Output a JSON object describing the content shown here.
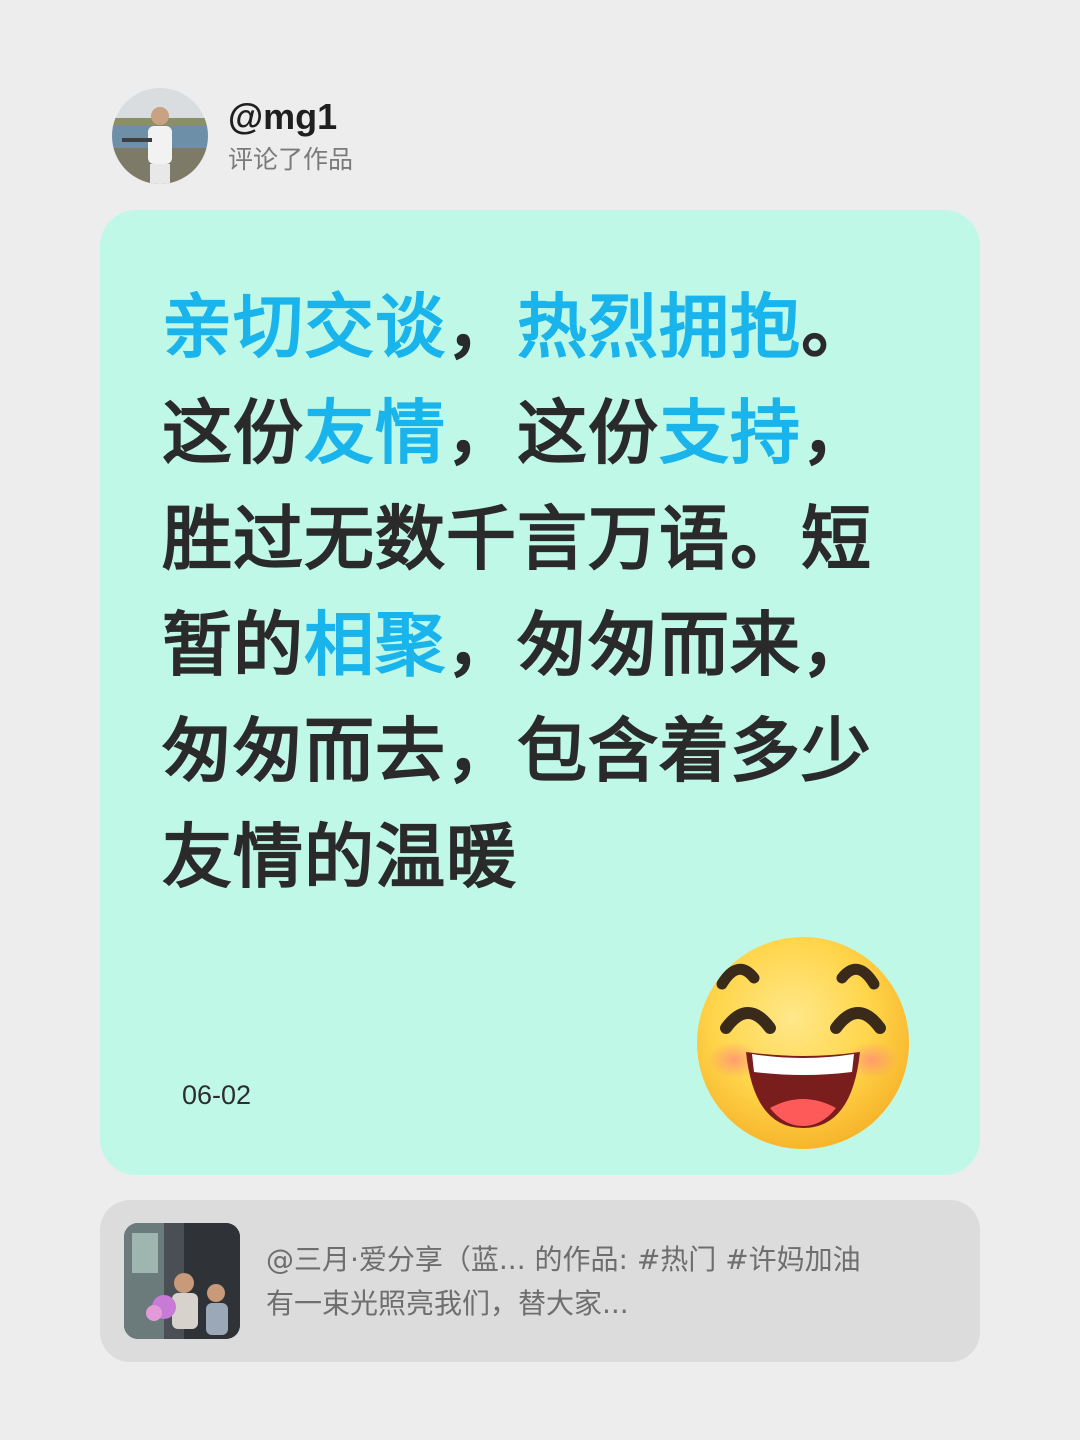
{
  "header": {
    "username": "@mg1",
    "action": "评论了作品"
  },
  "comment": {
    "lines": [
      [
        {
          "text": "亲切交谈",
          "hl": true
        },
        {
          "text": "，",
          "hl": false
        },
        {
          "text": "热烈拥抱",
          "hl": true
        },
        {
          "text": "。",
          "hl": false
        }
      ],
      [
        {
          "text": "这份",
          "hl": false
        },
        {
          "text": "友情",
          "hl": true
        },
        {
          "text": "，这份",
          "hl": false
        },
        {
          "text": "支持",
          "hl": true
        },
        {
          "text": "，",
          "hl": false
        }
      ],
      [
        {
          "text": "胜过无数千言万语。短",
          "hl": false
        }
      ],
      [
        {
          "text": "暂的",
          "hl": false
        },
        {
          "text": "相聚",
          "hl": true
        },
        {
          "text": "，匆匆而来，",
          "hl": false
        }
      ],
      [
        {
          "text": "匆匆而去，包含着多少",
          "hl": false
        }
      ],
      [
        {
          "text": "友情的温暖",
          "hl": false
        }
      ]
    ],
    "date": "06-02",
    "emoji": "grinning-face-emoji"
  },
  "reference": {
    "line1": "@三月·爱分享（蓝... 的作品: #热门 #许妈加油",
    "line2": "有一束光照亮我们，替大家..."
  },
  "colors": {
    "background": "#ededed",
    "card": "#c0f8e8",
    "highlight": "#19b4ec",
    "text": "#2a2a2a",
    "reference_card": "#dcdcdc"
  }
}
